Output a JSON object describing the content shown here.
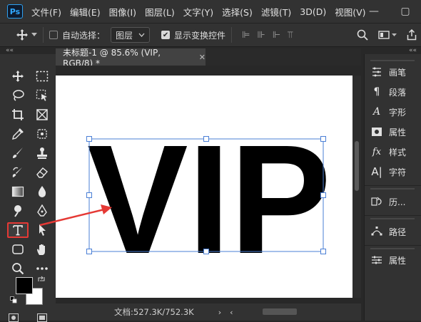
{
  "app": {
    "logo": "Ps"
  },
  "menu": [
    "文件(F)",
    "编辑(E)",
    "图像(I)",
    "图层(L)",
    "文字(Y)",
    "选择(S)",
    "滤镜(T)",
    "3D(D)",
    "视图(V)"
  ],
  "window_controls": {
    "minimize": "—",
    "maximize": "▢"
  },
  "options_bar": {
    "auto_select_label": "自动选择：",
    "auto_select_target": "图层",
    "show_transform_label": "显示变换控件"
  },
  "document": {
    "tab_title": "未标题-1 @ 85.6% (VIP, RGB/8) *",
    "canvas_text": "VIP"
  },
  "status": {
    "doc_info": "文档:527.3K/752.3K"
  },
  "panels": {
    "brush": "画笔",
    "paragraph": "段落",
    "character": "字形",
    "properties": "属性",
    "styles": "样式",
    "glyphs": "字符",
    "history": "历...",
    "paths": "路径",
    "adjust_props": "属性"
  },
  "colors": {
    "accent_highlight": "#e53935",
    "transform_box": "#4a7fd6",
    "foreground_swatch": "#000000",
    "background_swatch": "#ffffff"
  }
}
